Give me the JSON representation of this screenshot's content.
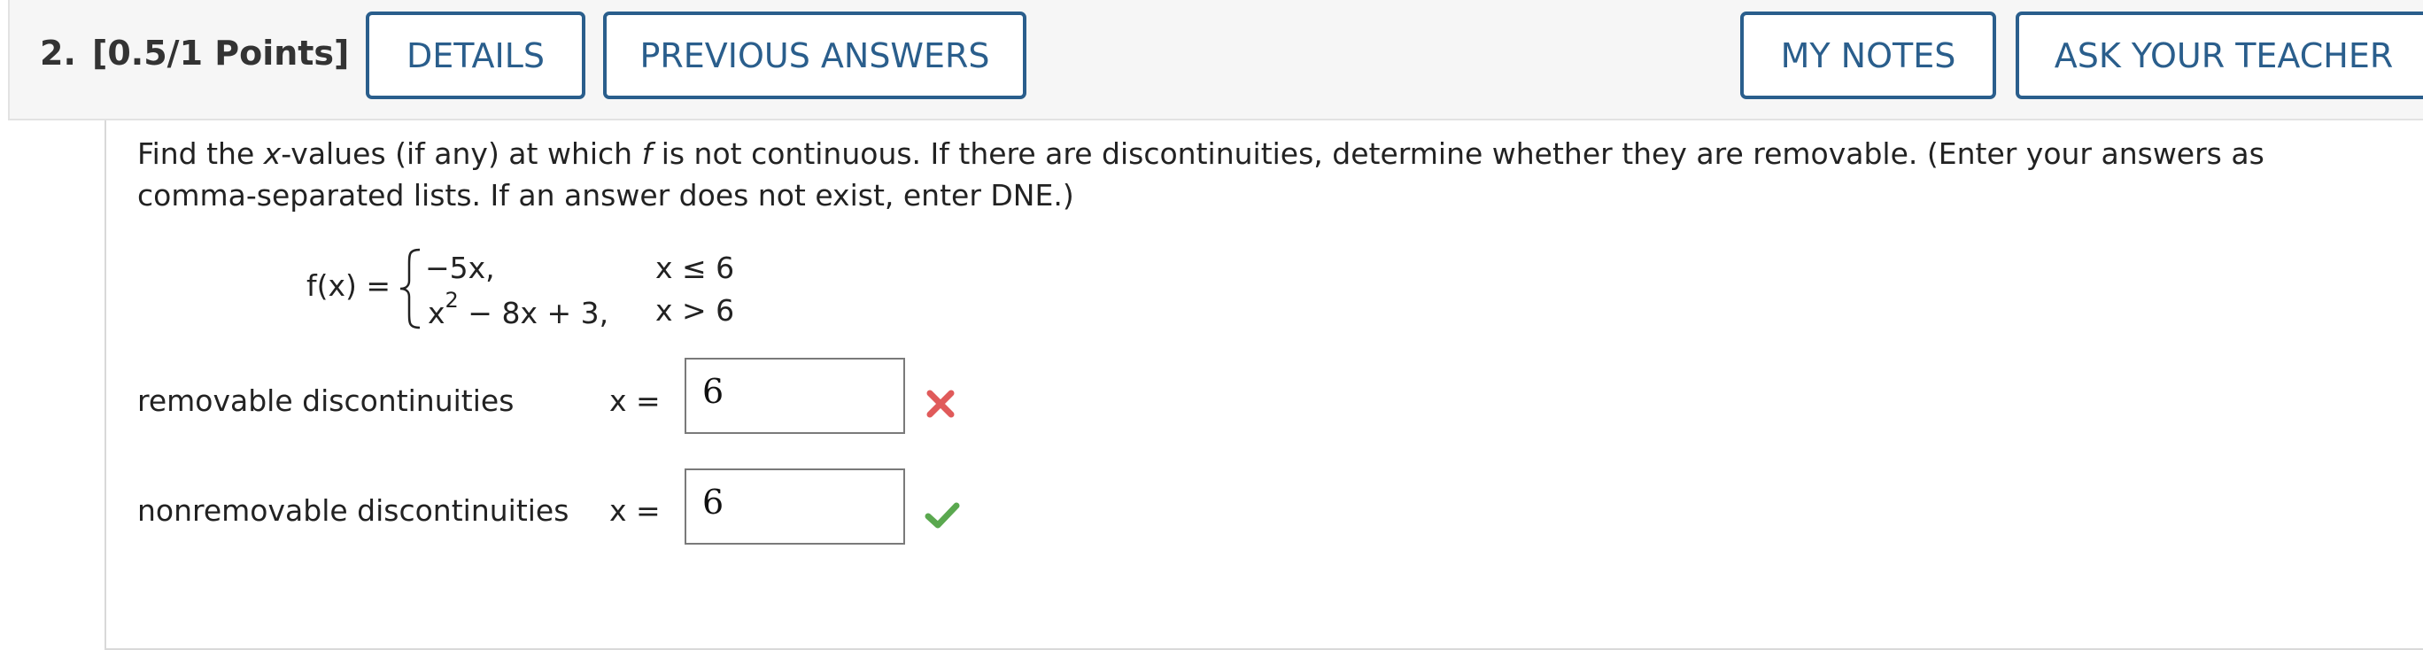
{
  "header": {
    "question_number": "2.",
    "points": "[0.5/1 Points]",
    "buttons": {
      "details": "DETAILS",
      "previous_answers": "PREVIOUS ANSWERS",
      "my_notes": "MY NOTES",
      "ask_teacher": "ASK YOUR TEACHER"
    }
  },
  "problem": {
    "prompt_parts": {
      "p1": "Find the ",
      "x1": "x",
      "p2": "-values (if any) at which ",
      "f1": "f",
      "p3": " is not continuous. If there are discontinuities, determine whether they are removable. (Enter your answers as comma-separated lists. If an answer does not exist, enter DNE.)"
    },
    "function": {
      "name": "f(x) =",
      "piece1_expr": "−5x,",
      "piece1_cond": "x ≤ 6",
      "piece2_expr_base": "x",
      "piece2_expr_exp": "2",
      "piece2_expr_rest": " − 8x + 3,",
      "piece2_cond": "x > 6"
    }
  },
  "answers": [
    {
      "label": "removable discontinuities",
      "var_label": "x =",
      "value": "6",
      "status": "incorrect",
      "status_icon": "x-mark-icon",
      "status_color": "#e05a5a"
    },
    {
      "label": "nonremovable discontinuities",
      "var_label": "x =",
      "value": "6",
      "status": "correct",
      "status_icon": "check-mark-icon",
      "status_color": "#5aa84f"
    }
  ],
  "colors": {
    "button_border": "#2a5e8c",
    "header_bg": "#f6f6f6",
    "top_strip": "#4a7fcf"
  }
}
